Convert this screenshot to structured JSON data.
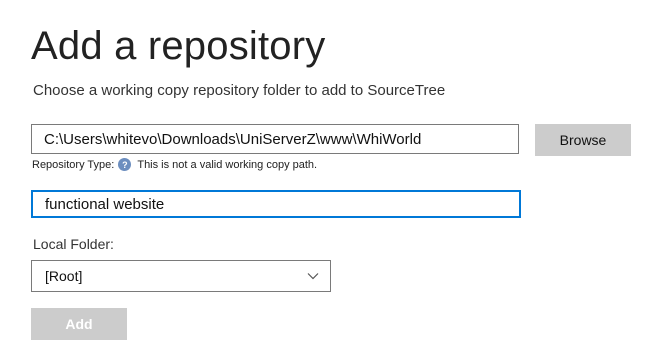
{
  "header": {
    "title": "Add a repository",
    "subtitle": "Choose a working copy repository folder to add to SourceTree"
  },
  "path": {
    "value": "C:\\Users\\whitevo\\Downloads\\UniServerZ\\www\\WhiWorld",
    "browse_label": "Browse"
  },
  "repo_type": {
    "label": "Repository Type:",
    "help_icon": "question-circle-icon",
    "status": "This is not a valid working copy path."
  },
  "name": {
    "value": "functional website"
  },
  "local_folder": {
    "label": "Local Folder:",
    "selected": "[Root]"
  },
  "actions": {
    "add_label": "Add"
  },
  "colors": {
    "focus_border": "#0078d7",
    "button_bg": "#cccccc",
    "help_icon_bg": "#6c8ebf"
  }
}
